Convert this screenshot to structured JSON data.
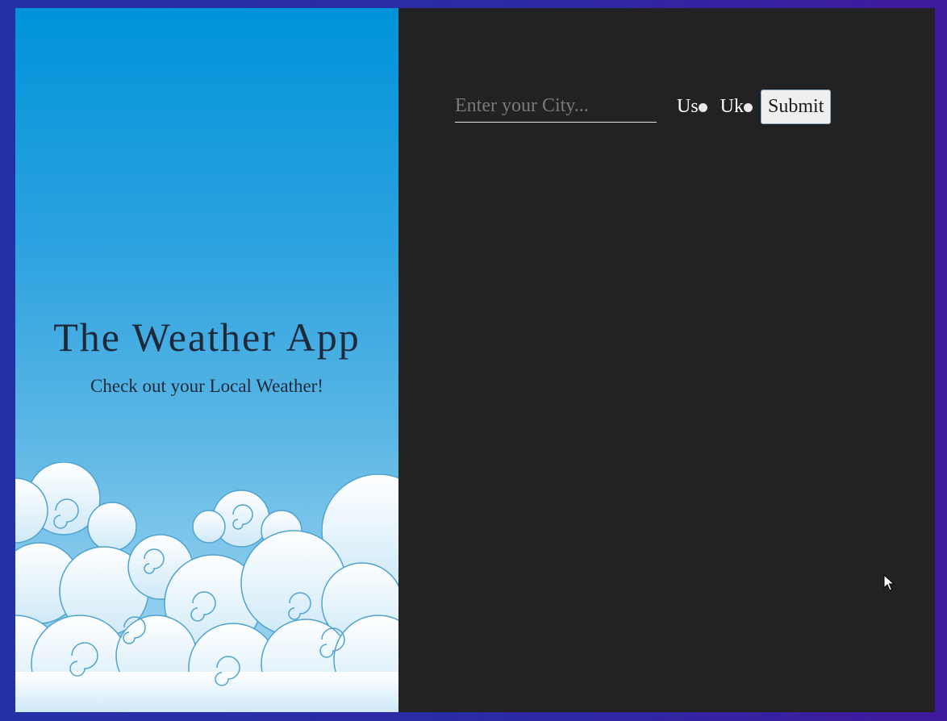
{
  "hero": {
    "title": "The Weather App",
    "subtitle": "Check out your Local Weather!"
  },
  "search": {
    "placeholder": "Enter your City...",
    "value": ""
  },
  "units": [
    {
      "label": "Us",
      "selected": false
    },
    {
      "label": "Uk",
      "selected": false
    }
  ],
  "submit_label": "Submit",
  "icons": {
    "cursor": "mouse-pointer-icon",
    "clouds": "clouds-illustration"
  },
  "colors": {
    "frame": "#2b2ba4",
    "left_panel_top": "#0093da",
    "left_panel_bottom": "#a8d9f2",
    "right_panel": "#222222",
    "title_text": "#1e2a3a"
  }
}
